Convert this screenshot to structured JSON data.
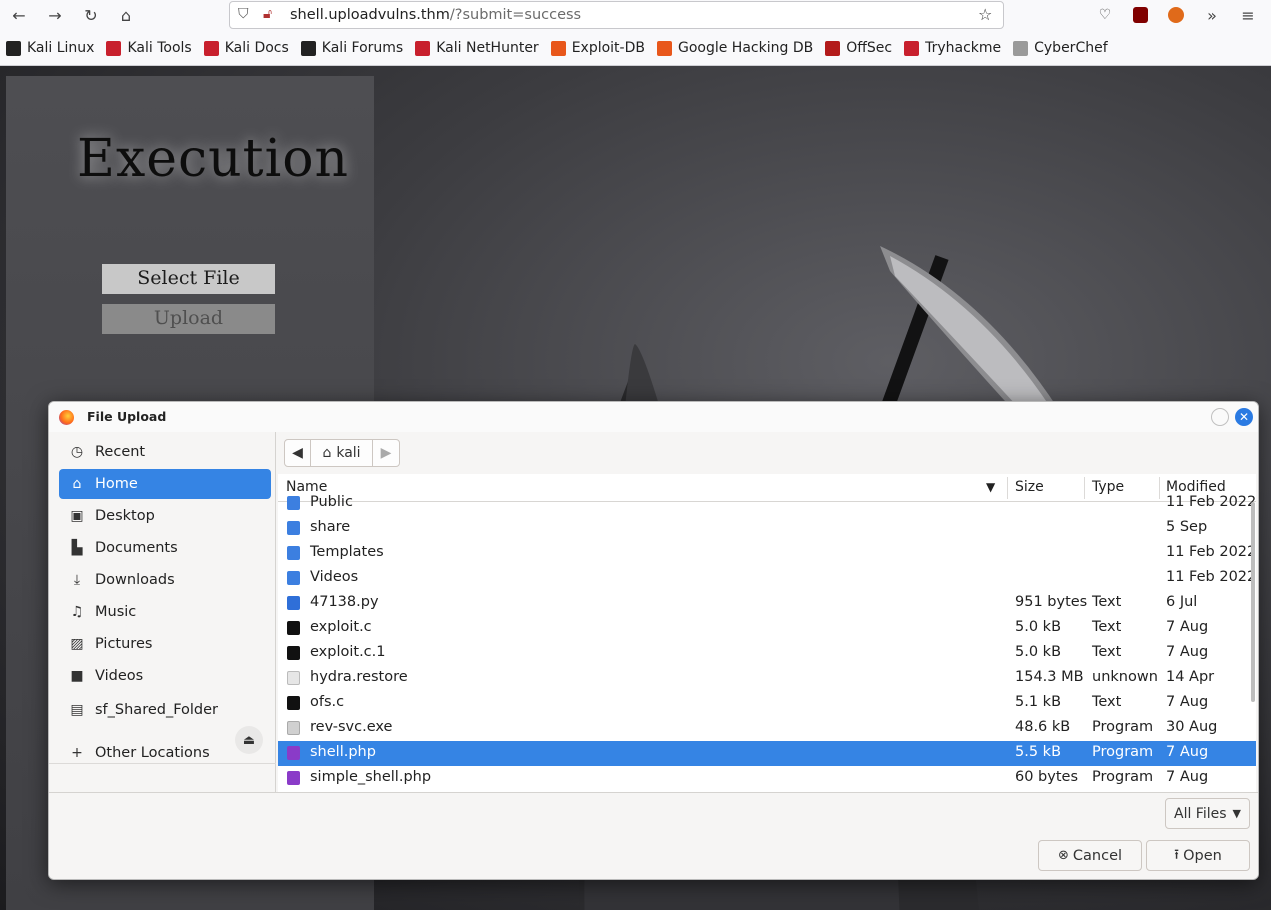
{
  "browser": {
    "url_domain": "shell.uploadvulns.thm",
    "url_path": "/?submit=success",
    "nav_icons": [
      "back-icon",
      "forward-icon",
      "reload-icon",
      "home-icon"
    ],
    "toolbar_icons": [
      "pocket-icon",
      "ublock-icon",
      "extension-icon",
      "overflow-icon",
      "menu-icon"
    ]
  },
  "bookmarks": [
    {
      "label": "Kali Linux",
      "color": "#222222"
    },
    {
      "label": "Kali Tools",
      "color": "#c8202d"
    },
    {
      "label": "Kali Docs",
      "color": "#c8202d"
    },
    {
      "label": "Kali Forums",
      "color": "#222222"
    },
    {
      "label": "Kali NetHunter",
      "color": "#c8202d"
    },
    {
      "label": "Exploit-DB",
      "color": "#e8571b"
    },
    {
      "label": "Google Hacking DB",
      "color": "#e8571b"
    },
    {
      "label": "OffSec",
      "color": "#b31b1b"
    },
    {
      "label": "Tryhackme",
      "color": "#c8202d"
    },
    {
      "label": "CyberChef",
      "color": "#9a9a9a"
    }
  ],
  "page": {
    "title": "Execution",
    "select_label": "Select File",
    "upload_label": "Upload"
  },
  "dialog": {
    "title": "File Upload",
    "sidebar": [
      {
        "label": "Recent",
        "icon": "clock-icon",
        "glyph": "◷"
      },
      {
        "label": "Home",
        "icon": "home-icon",
        "glyph": "⌂",
        "active": true
      },
      {
        "label": "Desktop",
        "icon": "desktop-icon",
        "glyph": "▣"
      },
      {
        "label": "Documents",
        "icon": "document-icon",
        "glyph": "▙"
      },
      {
        "label": "Downloads",
        "icon": "download-icon",
        "glyph": "⤓"
      },
      {
        "label": "Music",
        "icon": "music-icon",
        "glyph": "♫"
      },
      {
        "label": "Pictures",
        "icon": "pictures-icon",
        "glyph": "▨"
      },
      {
        "label": "Videos",
        "icon": "video-icon",
        "glyph": "■"
      },
      {
        "label": "sf_Shared_Folder",
        "icon": "drive-icon",
        "glyph": "▤"
      },
      {
        "label": "Other Locations",
        "icon": "plus-icon",
        "glyph": "+"
      }
    ],
    "path": "kali",
    "columns": {
      "name": "Name",
      "size": "Size",
      "type": "Type",
      "modified": "Modified"
    },
    "files": [
      {
        "name": "Public",
        "size": "",
        "type": "",
        "modified": "11 Feb 2022",
        "kind": "folder"
      },
      {
        "name": "share",
        "size": "",
        "type": "",
        "modified": "5 Sep",
        "kind": "folder"
      },
      {
        "name": "Templates",
        "size": "",
        "type": "",
        "modified": "11 Feb 2022",
        "kind": "folder"
      },
      {
        "name": "Videos",
        "size": "",
        "type": "",
        "modified": "11 Feb 2022",
        "kind": "folder"
      },
      {
        "name": "47138.py",
        "size": "951 bytes",
        "type": "Text",
        "modified": "6 Jul",
        "kind": "python"
      },
      {
        "name": "exploit.c",
        "size": "5.0 kB",
        "type": "Text",
        "modified": "7 Aug",
        "kind": "c"
      },
      {
        "name": "exploit.c.1",
        "size": "5.0 kB",
        "type": "Text",
        "modified": "7 Aug",
        "kind": "c"
      },
      {
        "name": "hydra.restore",
        "size": "154.3 MB",
        "type": "unknown",
        "modified": "14 Apr",
        "kind": "unknown"
      },
      {
        "name": "ofs.c",
        "size": "5.1 kB",
        "type": "Text",
        "modified": "7 Aug",
        "kind": "c"
      },
      {
        "name": "rev-svc.exe",
        "size": "48.6 kB",
        "type": "Program",
        "modified": "30 Aug",
        "kind": "exe"
      },
      {
        "name": "shell.php",
        "size": "5.5 kB",
        "type": "Program",
        "modified": "7 Aug",
        "kind": "php",
        "selected": true
      },
      {
        "name": "simple_shell.php",
        "size": "60 bytes",
        "type": "Program",
        "modified": "7 Aug",
        "kind": "php"
      }
    ],
    "filter": "All Files",
    "cancel": "Cancel",
    "open": "Open"
  },
  "colors": {
    "accent": "#3584e4",
    "folder": "#3c7fe0",
    "php": "#8a3bc8",
    "close_button": "#2a7ae2"
  }
}
